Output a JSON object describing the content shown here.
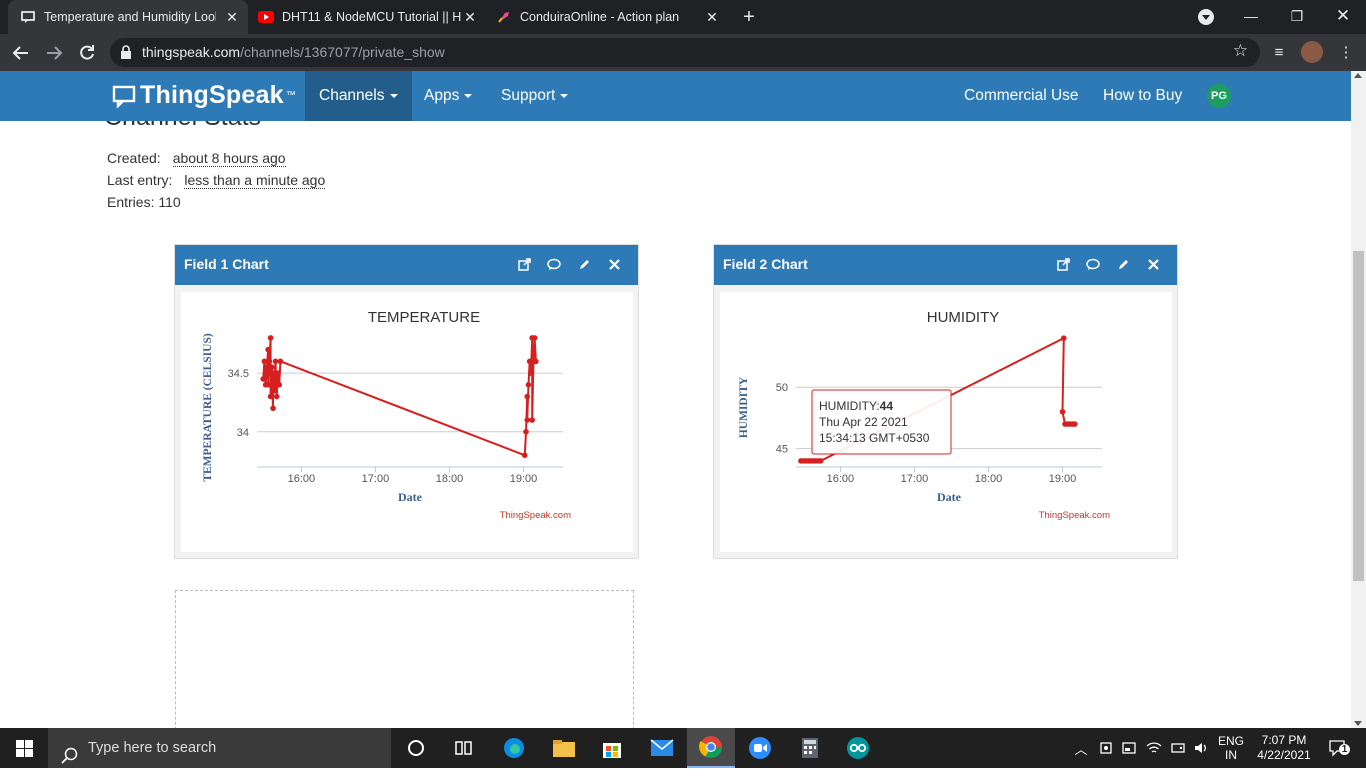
{
  "browser": {
    "tabs": [
      {
        "title": "Temperature and Humidity Look",
        "icon": "thingspeak-favicon",
        "active": true
      },
      {
        "title": "DHT11 & NodeMCU Tutorial || H",
        "icon": "youtube-favicon",
        "active": false
      },
      {
        "title": "ConduiraOnline - Action plan",
        "icon": "rocket-favicon",
        "active": false
      }
    ],
    "url_host": "thingspeak.com",
    "url_path": "/channels/1367077/private_show"
  },
  "nav": {
    "brand": "ThingSpeak",
    "trademark": "™",
    "items": [
      "Channels",
      "Apps",
      "Support"
    ],
    "right_items": [
      "Commercial Use",
      "How to Buy"
    ],
    "avatar_initials": "PG",
    "bar_color": "#2e7ab6"
  },
  "stats": {
    "heading": "Channel Stats",
    "created_label": "Created:",
    "created_value": "about 8 hours ago",
    "last_entry_label": "Last entry:",
    "last_entry_value": "less than a minute ago",
    "entries_label": "Entries: 110"
  },
  "panels": [
    {
      "title": "Field 1 Chart"
    },
    {
      "title": "Field 2 Chart"
    }
  ],
  "chart_data": [
    {
      "type": "line",
      "title": "TEMPERATURE",
      "xlabel": "Date",
      "ylabel": "TEMPERATURE (CELSIUS)",
      "credit": "ThingSpeak.com",
      "x_ticks": [
        "16:00",
        "17:00",
        "18:00",
        "19:00"
      ],
      "y_ticks": [
        34,
        34.5
      ],
      "x_range": [
        "15:24",
        "19:32"
      ],
      "y_range": [
        33.7,
        34.85
      ],
      "color": "#d62020",
      "series": [
        {
          "points": [
            [
              "15:29",
              34.45
            ],
            [
              "15:30",
              34.6
            ],
            [
              "15:31",
              34.4
            ],
            [
              "15:32",
              34.55
            ],
            [
              "15:33",
              34.7
            ],
            [
              "15:33",
              34.4
            ],
            [
              "15:34",
              34.6
            ],
            [
              "15:35",
              34.8
            ],
            [
              "15:35",
              34.3
            ],
            [
              "15:36",
              34.55
            ],
            [
              "15:37",
              34.2
            ],
            [
              "15:37",
              34.5
            ],
            [
              "15:38",
              34.35
            ],
            [
              "15:39",
              34.6
            ],
            [
              "15:40",
              34.3
            ],
            [
              "15:41",
              34.5
            ],
            [
              "15:42",
              34.4
            ],
            [
              "15:43",
              34.6
            ],
            [
              "19:01",
              33.8
            ],
            [
              "19:02",
              34.0
            ],
            [
              "19:03",
              34.3
            ],
            [
              "19:03",
              34.1
            ],
            [
              "19:04",
              34.4
            ],
            [
              "19:05",
              34.6
            ],
            [
              "19:06",
              34.5
            ],
            [
              "19:07",
              34.8
            ],
            [
              "19:07",
              34.1
            ],
            [
              "19:08",
              34.6
            ],
            [
              "19:09",
              34.8
            ],
            [
              "19:10",
              34.6
            ]
          ]
        }
      ]
    },
    {
      "type": "line",
      "title": "HUMIDITY",
      "xlabel": "Date",
      "ylabel": "HUMIDITY",
      "credit": "ThingSpeak.com",
      "x_ticks": [
        "16:00",
        "17:00",
        "18:00",
        "19:00"
      ],
      "y_ticks": [
        45,
        50
      ],
      "x_range": [
        "15:24",
        "19:32"
      ],
      "y_range": [
        43.5,
        54.5
      ],
      "color": "#d62020",
      "series": [
        {
          "points": [
            [
              "15:28",
              44
            ],
            [
              "15:30",
              44
            ],
            [
              "15:32",
              44
            ],
            [
              "15:34",
              44
            ],
            [
              "15:36",
              44
            ],
            [
              "15:38",
              44
            ],
            [
              "15:40",
              44
            ],
            [
              "15:42",
              44
            ],
            [
              "15:44",
              44
            ],
            [
              "19:01",
              54
            ],
            [
              "19:00",
              48
            ],
            [
              "19:02",
              47
            ],
            [
              "19:04",
              47
            ],
            [
              "19:06",
              47
            ],
            [
              "19:08",
              47
            ],
            [
              "19:10",
              47
            ]
          ]
        }
      ],
      "tooltip": {
        "label": "HUMIDITY:",
        "value": "44",
        "date": "Thu Apr 22 2021",
        "time": "15:34:13 GMT+0530"
      }
    }
  ],
  "taskbar": {
    "search_placeholder": "Type here to search",
    "lang_top": "ENG",
    "lang_bottom": "IN",
    "clock_time": "7:07 PM",
    "clock_date": "4/22/2021",
    "notification_count": "1"
  }
}
